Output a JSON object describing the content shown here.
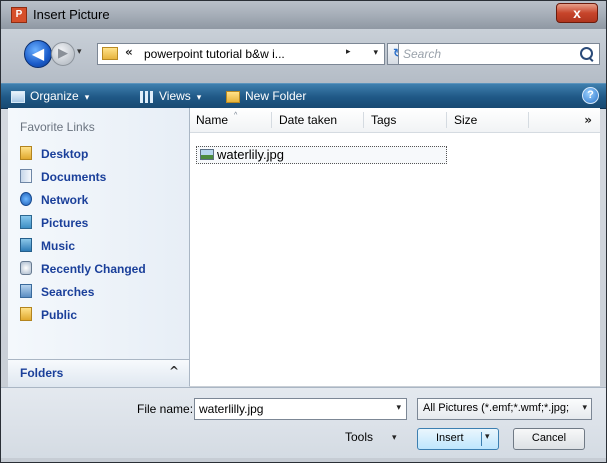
{
  "window": {
    "title": "Insert Picture",
    "close_label": "x",
    "app_icon_letter": "P"
  },
  "address": {
    "overflow": "«",
    "path": "powerpoint tutorial b&w i...",
    "crumb_arrow": "▸",
    "dropdown": "▾",
    "refresh": "↻",
    "back": "◀",
    "forward": "▶",
    "history_dropdown": "▾"
  },
  "search": {
    "placeholder": "Search",
    "value": ""
  },
  "toolbar": {
    "organize": "Organize",
    "views": "Views",
    "new_folder": "New Folder",
    "dropdown": "▾",
    "help": "?"
  },
  "nav": {
    "heading": "Favorite Links",
    "items": [
      {
        "label": "Desktop",
        "icon": "desktop-folder-icon"
      },
      {
        "label": "Documents",
        "icon": "documents-icon"
      },
      {
        "label": "Network",
        "icon": "network-icon"
      },
      {
        "label": "Pictures",
        "icon": "pictures-icon"
      },
      {
        "label": "Music",
        "icon": "music-icon"
      },
      {
        "label": "Recently Changed",
        "icon": "recently-changed-icon"
      },
      {
        "label": "Searches",
        "icon": "searches-icon"
      },
      {
        "label": "Public",
        "icon": "public-folder-icon"
      }
    ],
    "folders_label": "Folders",
    "folders_chevron": "^"
  },
  "filelist": {
    "columns": [
      "Name",
      "Date taken",
      "Tags",
      "Size"
    ],
    "sort_indicator": "^",
    "more": "»",
    "files": [
      {
        "name": "waterlily.jpg",
        "icon": "image-file-icon"
      }
    ]
  },
  "bottom": {
    "file_name_label": "File name:",
    "file_name_value": "waterlilly.jpg",
    "filter_value": "All Pictures (*.emf;*.wmf;*.jpg;",
    "dropdown": "▾",
    "tools_label": "Tools",
    "insert_label": "Insert",
    "cancel_label": "Cancel"
  },
  "colors": {
    "toolbar": "#1f5886",
    "nav_link": "#1a3f9a",
    "close": "#c7452b"
  }
}
